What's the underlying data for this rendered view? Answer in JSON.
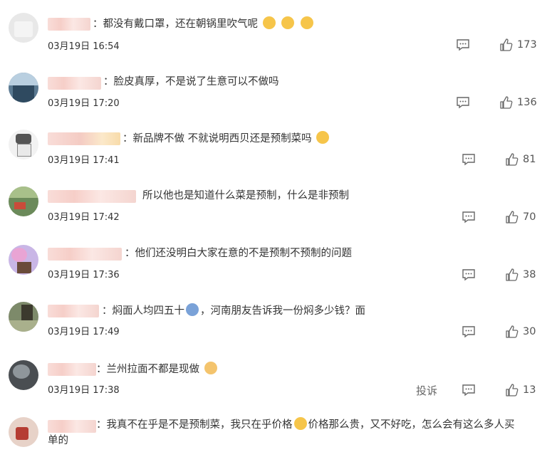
{
  "comments": [
    {
      "text_before": "：都没有戴口罩，还在朝锅里吹气呢",
      "text_after": "",
      "time": "03月19日 16:54",
      "likes": "173",
      "emoji": [
        "laugh-cry-emoji",
        "laugh-cry-emoji",
        "laugh-cry-emoji"
      ]
    },
    {
      "text_before": "：脸皮真厚，不是说了生意可以不做吗",
      "text_after": "",
      "time": "03月19日 17:20",
      "likes": "136"
    },
    {
      "text_before": "：新品牌不做 不就说明西贝还是预制菜吗",
      "text_after": "",
      "time": "03月19日 17:41",
      "likes": "81",
      "emoji": [
        "thinking-emoji"
      ]
    },
    {
      "text_before": "所以他也是知道什么菜是预制，什么是非预制",
      "text_after": "",
      "time": "03月19日 17:42",
      "likes": "70"
    },
    {
      "text_before": "：他们还没明白大家在意的不是预制不预制的问题",
      "text_after": "",
      "time": "03月19日 17:36",
      "likes": "38"
    },
    {
      "text_before": "：焖面人均四五十",
      "text_after": "，河南朋友告诉我一份焖多少钱？面",
      "time": "03月19日 17:49",
      "likes": "30",
      "emoji": [
        "husky-emoji"
      ]
    },
    {
      "text_before": "：兰州拉面不都是现做",
      "text_after": "",
      "time": "03月19日 17:38",
      "likes": "13",
      "report": "投诉",
      "emoji": [
        "doge-emoji"
      ]
    },
    {
      "text_before": "：我真不在乎是不是预制菜，我只在乎价格",
      "text_after": "价格那么贵，又不好吃，怎么会有这么多人买",
      "text_line2": "单的",
      "emoji": [
        "laugh-cry-emoji"
      ]
    }
  ]
}
